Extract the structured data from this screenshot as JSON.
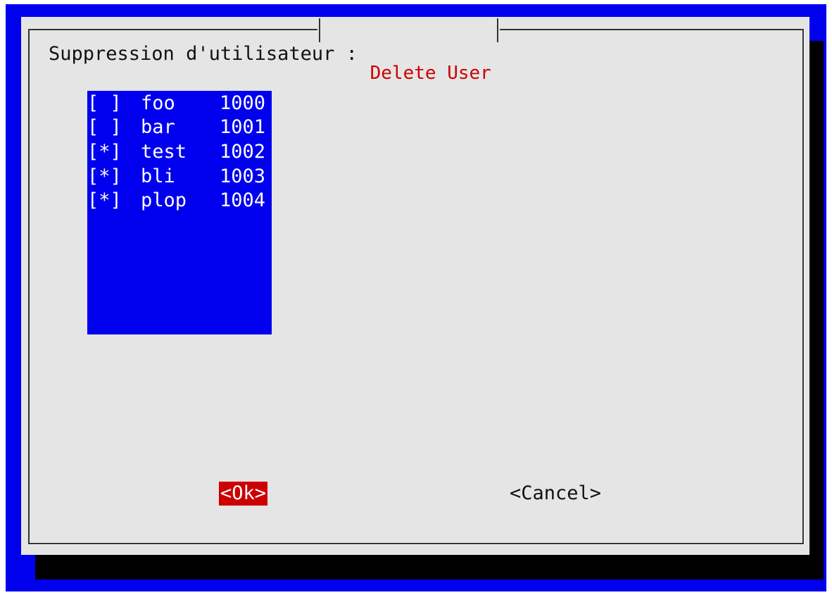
{
  "dialog": {
    "title": "Delete User",
    "prompt": "Suppression d'utilisateur :"
  },
  "users": [
    {
      "checkbox": "[ ]",
      "name": "foo",
      "uid": "1000",
      "checked": false
    },
    {
      "checkbox": "[ ]",
      "name": "bar",
      "uid": "1001",
      "checked": false
    },
    {
      "checkbox": "[*]",
      "name": "test",
      "uid": "1002",
      "checked": true
    },
    {
      "checkbox": "[*]",
      "name": "bli",
      "uid": "1003",
      "checked": true
    },
    {
      "checkbox": "[*]",
      "name": "plop",
      "uid": "1004",
      "checked": true
    }
  ],
  "buttons": {
    "ok": "<Ok>",
    "cancel": "<Cancel>"
  },
  "colors": {
    "background": "#0000ee",
    "dialog": "#e5e5e5",
    "title": "#cc0000",
    "selected_button": "#cc0000"
  }
}
